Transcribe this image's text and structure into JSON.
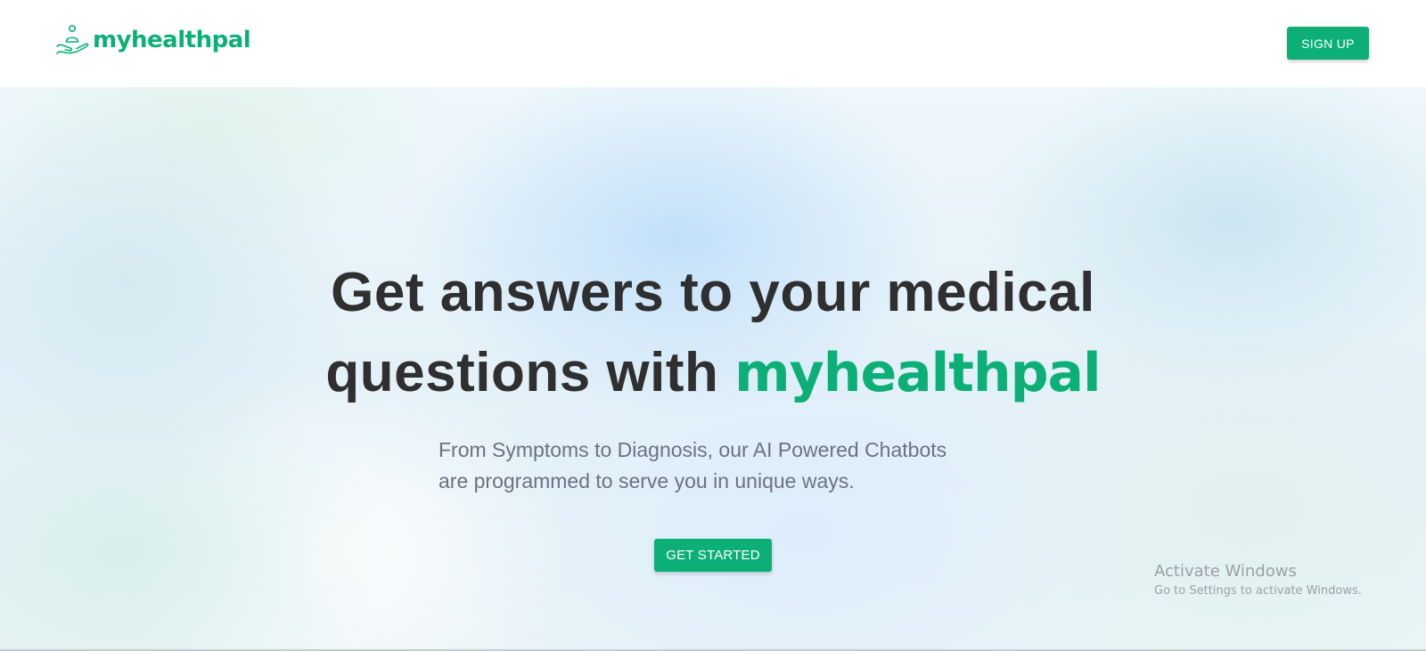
{
  "colors": {
    "accent": "#0cb077",
    "headline": "#2f2f2f",
    "subtext": "#6b7280"
  },
  "header": {
    "logo_icon": "person-in-hand-icon",
    "logo_text": "myhealthpal",
    "signup_label": "SIGN UP"
  },
  "hero": {
    "headline_line1": "Get answers to your medical",
    "headline_line2_prefix": "questions with",
    "headline_brand": "myhealthpal",
    "subtext_line1": "From Symptoms to Diagnosis, our AI Powered Chatbots",
    "subtext_line2": "are programmed to serve you in unique ways.",
    "cta_label": "GET STARTED"
  },
  "os_watermark": {
    "title": "Activate Windows",
    "subtitle": "Go to Settings to activate Windows."
  }
}
